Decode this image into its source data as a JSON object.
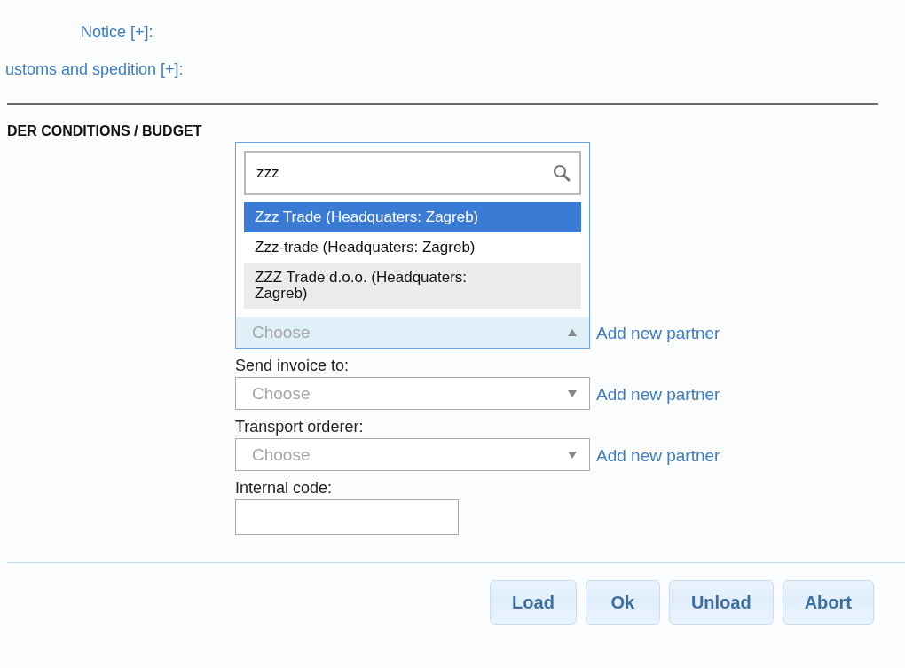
{
  "links": [
    "Notice [+]:",
    "ustoms and spedition [+]:"
  ],
  "section_title": "DER CONDITIONS / BUDGET",
  "fields": [
    {
      "kind": "select",
      "open": true,
      "search": "zzz",
      "options": [
        {
          "label": "Zzz Trade (Headquaters: Zagreb)",
          "selected": true,
          "hovered": false
        },
        {
          "label": "Zzz-trade (Headquaters: Zagreb)",
          "selected": false,
          "hovered": false
        },
        {
          "label": "ZZZ Trade d.o.o. (Headquaters: Zagreb)",
          "selected": false,
          "hovered": true
        }
      ],
      "placeholder": "Choose",
      "link": "Add new partner"
    },
    {
      "kind": "select",
      "label": "Send invoice to:",
      "open": false,
      "placeholder": "Choose",
      "link": "Add new partner"
    },
    {
      "kind": "select",
      "label": "Transport orderer:",
      "open": false,
      "placeholder": "Choose",
      "link": "Add new partner"
    },
    {
      "kind": "text",
      "label": "Internal code:"
    }
  ],
  "buttons": [
    "Load",
    "Ok",
    "Unload",
    "Abort"
  ]
}
